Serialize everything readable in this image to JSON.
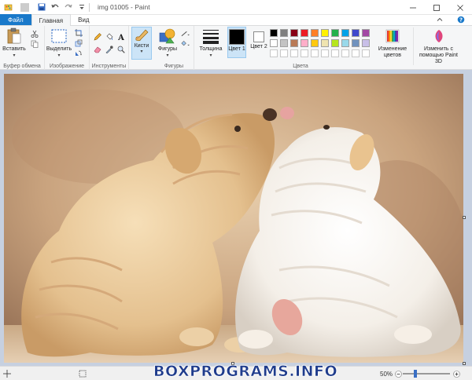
{
  "window": {
    "title": "img 01005 - Paint"
  },
  "tabs": {
    "file": "Файл",
    "home": "Главная",
    "view": "Вид"
  },
  "groups": {
    "clipboard": {
      "label": "Буфер обмена",
      "paste": "Вставить"
    },
    "image": {
      "label": "Изображение",
      "select": "Выделить"
    },
    "tools": {
      "label": "Инструменты"
    },
    "brushes": {
      "label": "Кисти"
    },
    "shapes": {
      "label": "Фигуры",
      "shapes_btn": "Фигуры"
    },
    "size": {
      "label": "Толщина"
    },
    "colors": {
      "label": "Цвета",
      "color1": "Цвет 1",
      "color2": "Цвет 2",
      "edit": "Изменение цветов",
      "paint3d": "Изменить с помощью Paint 3D",
      "palette_row1": [
        "#000000",
        "#7f7f7f",
        "#880015",
        "#ed1c24",
        "#ff7f27",
        "#fff200",
        "#22b14c",
        "#00a2e8",
        "#3f48cc",
        "#a349a4"
      ],
      "palette_row2": [
        "#ffffff",
        "#c3c3c3",
        "#b97a57",
        "#ffaec9",
        "#ffc90e",
        "#efe4b0",
        "#b5e61d",
        "#99d9ea",
        "#7092be",
        "#c8bfe7"
      ]
    }
  },
  "status": {
    "zoom": "50%",
    "watermark": "BOXPROGRAMS.INFO"
  }
}
